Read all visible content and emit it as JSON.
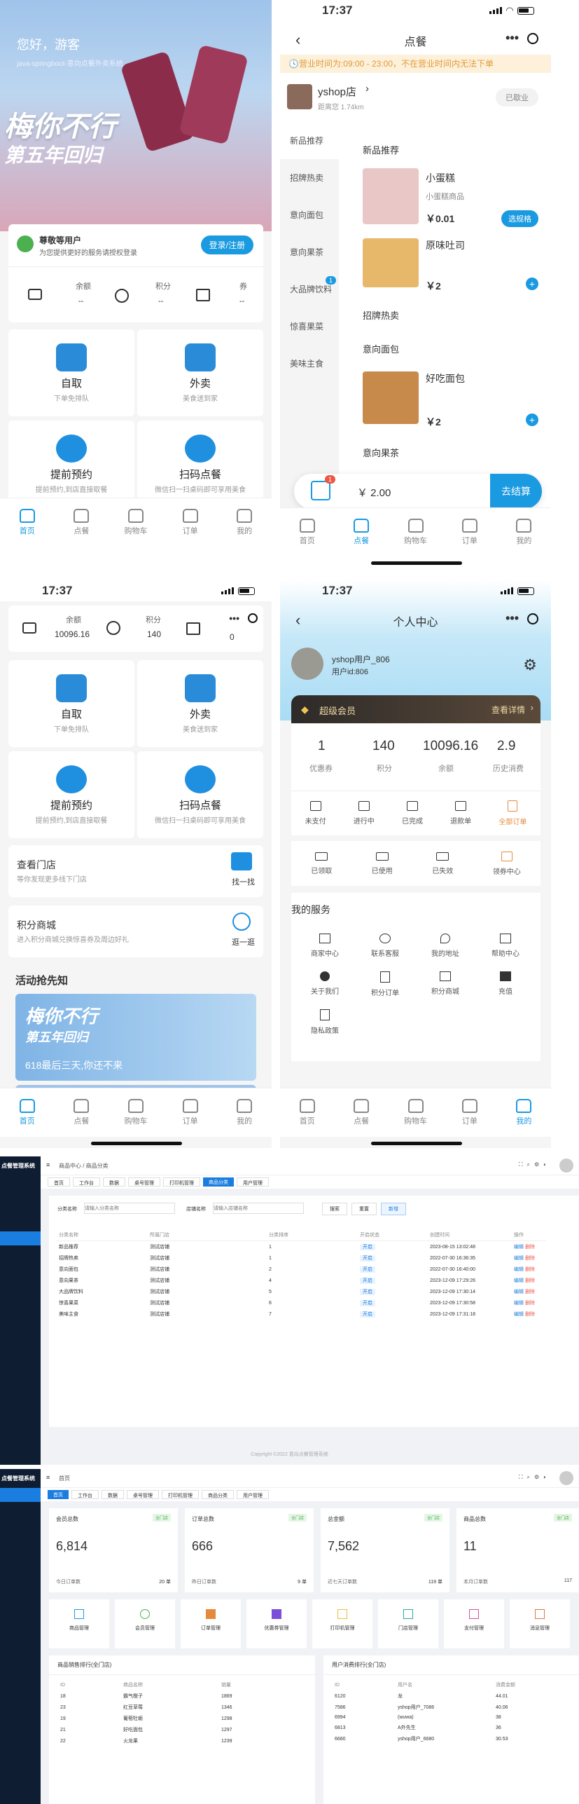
{
  "status": {
    "time": "17:37"
  },
  "home": {
    "greeting": "您好，游客",
    "slogan": "java-springboot-意向点餐外卖系统",
    "banner_title": "梅你不行",
    "banner_sub": "第五年回归",
    "member_title": "尊敬等用户",
    "member_desc": "为您提供更好的服务请授权登录",
    "login_btn": "登录/注册",
    "assets": [
      {
        "label": "余额",
        "value": "--"
      },
      {
        "label": "积分",
        "value": "--"
      },
      {
        "label": "券",
        "value": "--"
      }
    ],
    "services": [
      {
        "title": "自取",
        "sub": "下单免排队"
      },
      {
        "title": "外卖",
        "sub": "美食送到家"
      },
      {
        "title": "提前预约",
        "sub": "提前预约,到店直接取餐"
      },
      {
        "title": "扫码点餐",
        "sub": "微信扫一扫桌码即可享用美食"
      }
    ]
  },
  "tabs": [
    "首页",
    "点餐",
    "购物车",
    "订单",
    "我的"
  ],
  "order": {
    "page_title": "点餐",
    "notice": "营业时间为:09:00 - 23:00，不在营业时间内无法下单",
    "shop_name": "yshop店",
    "distance": "距离您 1.74km",
    "closed": "已歇业",
    "categories": [
      "新品推荐",
      "招牌热卖",
      "意向面包",
      "意向果茶",
      "大品牌饮料",
      "惊喜果菜",
      "美味主食"
    ],
    "badge_count": "1",
    "sections": [
      "新品推荐",
      "招牌热卖",
      "意向面包",
      "意向果茶"
    ],
    "products": [
      {
        "name": "小蛋糕",
        "desc": "小蛋糕商品",
        "price": "￥0.01",
        "action": "选规格"
      },
      {
        "name": "原味吐司",
        "price": "￥2"
      },
      {
        "name": "好吃面包",
        "price": "￥2"
      }
    ],
    "cart_badge": "1",
    "cart_total": "￥ 2.00",
    "checkout": "去结算"
  },
  "home2": {
    "balance_label": "余额",
    "balance": "10096.16",
    "points_label": "积分",
    "points": "140",
    "coupon_value": "0",
    "store_title": "查看门店",
    "store_sub": "等你发现更多线下门店",
    "store_btn": "找一找",
    "mall_title": "积分商城",
    "mall_sub": "进入积分商城兑换惊喜券及周边好礼",
    "mall_btn": "逛一逛",
    "activity": "活动抢先知",
    "banner_caption": "618最后三天,你还不来",
    "banner_title": "梅你不行",
    "banner_sub": "第五年回归"
  },
  "profile": {
    "page_title": "个人中心",
    "user_name": "yshop用户_806",
    "user_id": "用户id:806",
    "vip": "超级会员",
    "vip_link": "查看详情",
    "stats": [
      {
        "v": "1",
        "l": "优惠券"
      },
      {
        "v": "140",
        "l": "积分"
      },
      {
        "v": "10096.16",
        "l": "余额"
      },
      {
        "v": "2.9",
        "l": "历史消费"
      }
    ],
    "orders": [
      "未支付",
      "进行中",
      "已完成",
      "退款单",
      "全部订单"
    ],
    "coupons": [
      "已领取",
      "已使用",
      "已失效",
      "领券中心"
    ],
    "services_title": "我的服务",
    "services": [
      "商家中心",
      "联系客服",
      "我的地址",
      "帮助中心",
      "关于我们",
      "积分订单",
      "积分商城",
      "充值",
      "隐私政策"
    ]
  },
  "admin": {
    "system": "点餐管理系统",
    "breadcrumb1": "商品中心 / 商品分类",
    "tabs1": [
      "首页",
      "工作台",
      "数据",
      "桌号管理",
      "打印机管理",
      "商品分类",
      "用户管理"
    ],
    "filter_name": "分类名称",
    "filter_name_ph": "请输入分类名称",
    "filter_store": "店铺名称",
    "filter_store_ph": "请输入店铺名称",
    "btn_search": "搜索",
    "btn_reset": "重置",
    "btn_add": "新增",
    "cols": [
      "分类名称",
      "所属门店",
      "分类排序",
      "开启状态",
      "创建时间",
      "操作"
    ],
    "rows": [
      [
        "新品推荐",
        "测试店铺",
        "1",
        "开启",
        "2023-08-15 13:02:48"
      ],
      [
        "招牌热卖",
        "测试店铺",
        "1",
        "开启",
        "2022-07-30 16:36:35"
      ],
      [
        "意向面包",
        "测试店铺",
        "2",
        "开启",
        "2022-07-30 16:40:00"
      ],
      [
        "意向果茶",
        "测试店铺",
        "4",
        "开启",
        "2023-12-09 17:29:26"
      ],
      [
        "大品牌饮料",
        "测试店铺",
        "5",
        "开启",
        "2023-12-09 17:30:14"
      ],
      [
        "惊喜果菜",
        "测试店铺",
        "6",
        "开启",
        "2023-12-09 17:30:58"
      ],
      [
        "美味主食",
        "测试店铺",
        "7",
        "开启",
        "2023-12-09 17:31:18"
      ]
    ],
    "op_edit": "编辑",
    "op_del": "删除",
    "copyright": "Copyright ©2022 意向点餐管理系统",
    "breadcrumb2": "首页",
    "tabs2": [
      "首页",
      "工作台",
      "数据",
      "桌号管理",
      "打印机管理",
      "商品分类",
      "用户管理"
    ],
    "kpis": [
      {
        "t": "会员总数",
        "v": "6,814",
        "f": "今日订单数",
        "fv": "20 单"
      },
      {
        "t": "订单总数",
        "v": "666",
        "f": "昨日订单数",
        "fv": "9 单"
      },
      {
        "t": "总金额",
        "v": "7,562",
        "f": "近七天订单数",
        "fv": "119 单"
      },
      {
        "t": "商品总数",
        "v": "11",
        "f": "本月订单数",
        "fv": "117"
      }
    ],
    "kpi_tag": "全门店",
    "shortcuts": [
      "商品管理",
      "会员管理",
      "订单管理",
      "优惠券管理",
      "打印机管理",
      "门店管理",
      "支付管理",
      "消息管理"
    ],
    "rank1_title": "商品销售排行(全门店)",
    "rank1_cols": [
      "ID",
      "商品名称",
      "销量"
    ],
    "rank1": [
      [
        "18",
        "霸气橙子",
        "1869"
      ],
      [
        "23",
        "红豆草莓",
        "1346"
      ],
      [
        "19",
        "葡萄牡蛎",
        "1298"
      ],
      [
        "21",
        "好吃面包",
        "1297"
      ],
      [
        "22",
        "火龙果",
        "1239"
      ]
    ],
    "rank2_title": "用户消费排行(全门店)",
    "rank2_cols": [
      "ID",
      "用户名",
      "消费金额"
    ],
    "rank2": [
      [
        "6120",
        "龙",
        "44.01"
      ],
      [
        "7586",
        "yshop用户_7086",
        "40.06"
      ],
      [
        "6994",
        "(wuwa)",
        "38"
      ],
      [
        "6813",
        "A外先生",
        "36"
      ],
      [
        "6680",
        "yshop用户_6680",
        "30.53"
      ]
    ]
  }
}
